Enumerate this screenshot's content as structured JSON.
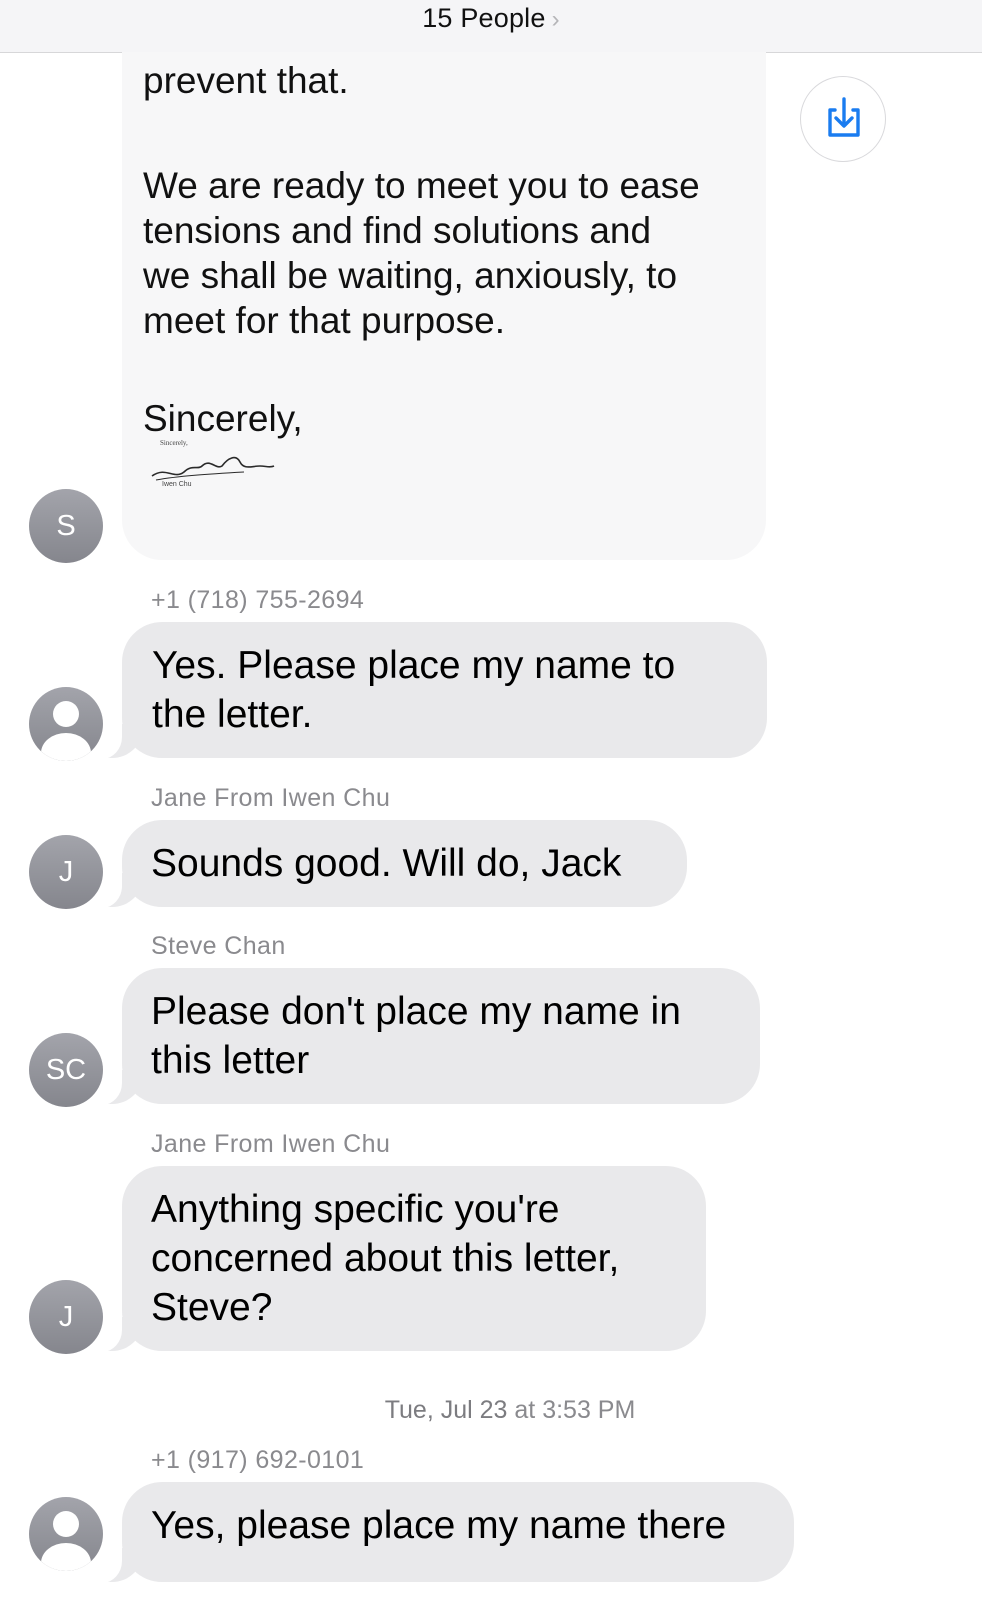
{
  "header": {
    "title": "15 People",
    "chevron": "›"
  },
  "letter": {
    "line_top": "prevent that.",
    "paragraph": "We are ready to meet you to ease\ntensions and find solutions and\nwe shall be waiting, anxiously, to\nmeet for that purpose.",
    "closing": "Sincerely,",
    "sender_initial": "S",
    "signature_small_text": "Sincerely,",
    "signature_name": "Iwen Chu"
  },
  "messages": [
    {
      "sender": "+1 (718) 755-2694",
      "text": "  Yes. Please place my name to\nthe letter.",
      "avatar": "person-icon"
    },
    {
      "sender": "Jane From Iwen Chu",
      "text": "Sounds good. Will do, Jack",
      "avatar_initials": "J"
    },
    {
      "sender": "Steve  Chan",
      "text": "Please don't place my name in\nthis letter",
      "avatar_initials": "SC"
    },
    {
      "sender": "Jane From Iwen Chu",
      "text": "Anything specific you're\nconcerned about this letter,\nSteve?",
      "avatar_initials": "J"
    },
    {
      "sender": "+1 (917) 692-0101",
      "text": "Yes, please place my name there",
      "avatar": "person-icon"
    }
  ],
  "timestamp": {
    "day": "Tue, Jul 23",
    "at": " at ",
    "time": "3:53 PM"
  },
  "colors": {
    "bubble": "#e9e9eb",
    "avatar": "#8e8e93",
    "accent": "#1a7cf0",
    "meta": "#8a8a8e"
  },
  "icons": {
    "save": "download-into-tray-icon"
  }
}
